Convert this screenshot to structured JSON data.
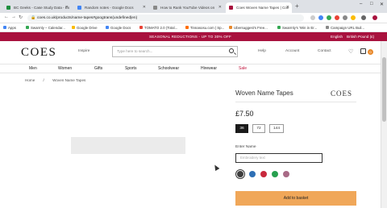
{
  "browser": {
    "tabs": [
      {
        "title": "BC Geeks - Case Study Data - Ex",
        "color": "#1e8e3e"
      },
      {
        "title": "Random notes - Google Docs",
        "color": "#4285f4"
      },
      {
        "title": "How to Rank YouTube Videos on",
        "color": "#888888"
      },
      {
        "title": "Coes Woven Name Tapes | Coe",
        "color": "#a8123e"
      }
    ],
    "new_tab": "+",
    "url": "coes.co.uk/products/name-tapes#googtrans(undefined|en)",
    "bookmarks": [
      {
        "label": "Apps",
        "color": "#4285f4"
      },
      {
        "label": "Swarmly – Calendar...",
        "color": "#34a853"
      },
      {
        "label": "Google Drive",
        "color": "#fbbc05"
      },
      {
        "label": "Google Docs",
        "color": "#4285f4"
      },
      {
        "label": "TOMATO 2.0 (Total...",
        "color": "#ea4335"
      },
      {
        "label": "Tinnasosu.com | Sp...",
        "color": "#ff6d00"
      },
      {
        "label": "Ubersuggest's Free...",
        "color": "#e8892c"
      },
      {
        "label": "Swarmly's 'Win in Er...",
        "color": "#34a853"
      },
      {
        "label": "Campaign URL Buil...",
        "color": "#888888"
      }
    ]
  },
  "promo": {
    "message": "SEASONAL REDUCTIONS - UP TO 30% OFF",
    "language": "English",
    "currency": "British Pound (£)"
  },
  "header": {
    "logo": "COES",
    "inspire": "Inspire",
    "search_placeholder": "Type here to search...",
    "help": "Help",
    "account": "Account",
    "contact": "Contact",
    "basket_count": "0"
  },
  "nav": [
    "Men",
    "Women",
    "Gifts",
    "Sports",
    "Schoolwear",
    "Hirewear",
    "Sale"
  ],
  "breadcrumb": [
    "Home",
    "/",
    "Woven Name Tapes"
  ],
  "product": {
    "title": "Woven Name Tapes",
    "brand": "COES",
    "price": "£7.50",
    "quantities": [
      "36",
      "72",
      "144"
    ],
    "selected_quantity": "36",
    "enter_name_label": "Enter Name",
    "name_placeholder": "Embroidery text",
    "colors": [
      "#3d3d3d",
      "#2e6fb5",
      "#c8283c",
      "#27a04f",
      "#a86a86"
    ],
    "add_to_basket": "Add to basket"
  }
}
